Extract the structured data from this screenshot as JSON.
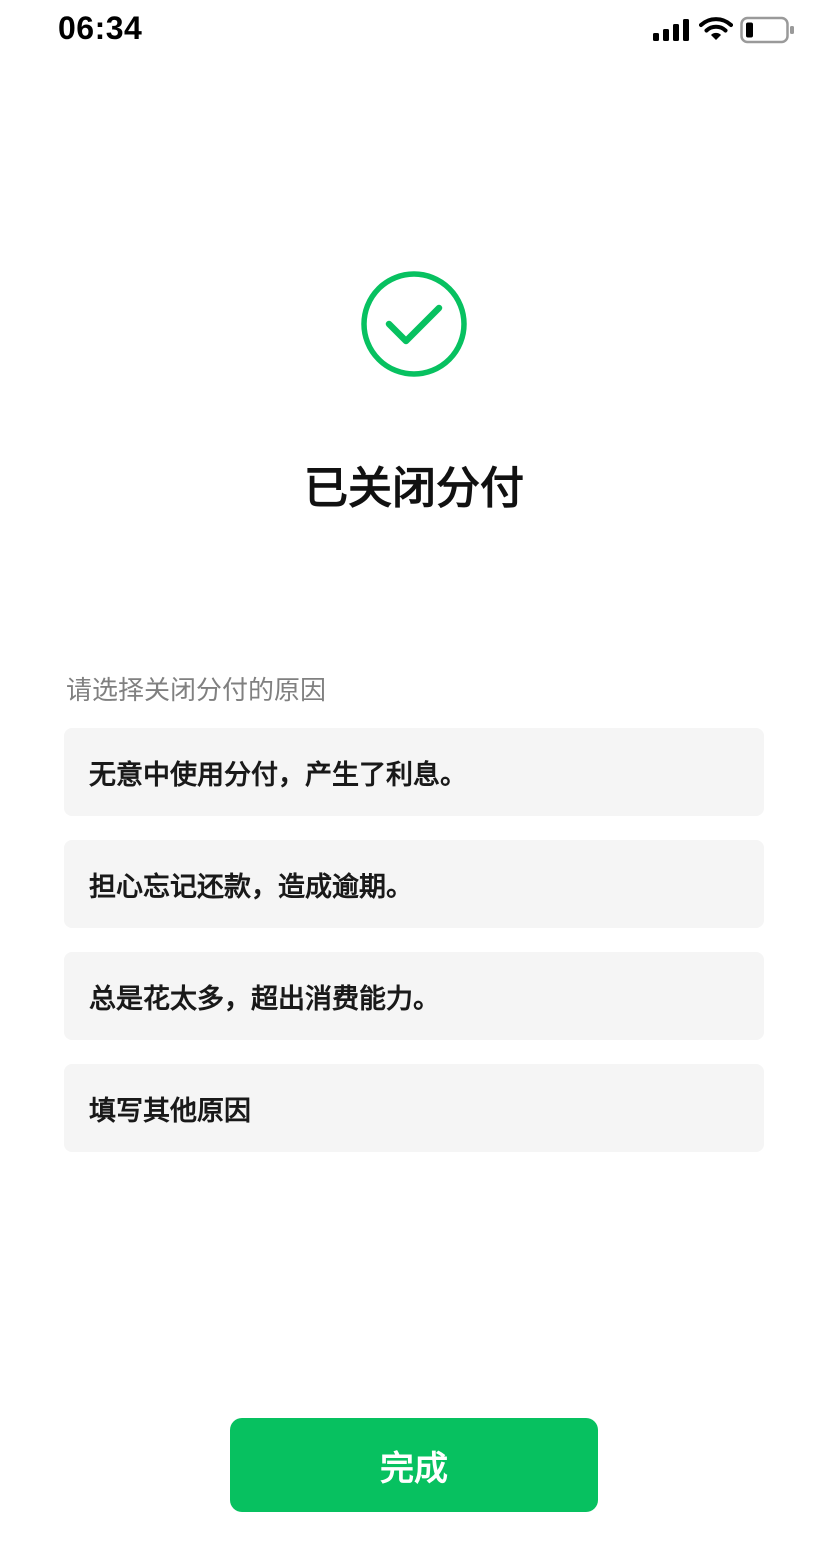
{
  "status_bar": {
    "time": "06:34",
    "icons": [
      "signal-icon",
      "wifi-icon",
      "battery-icon"
    ]
  },
  "success": {
    "icon": "check-circle-icon",
    "color": "#07c160"
  },
  "title": "已关闭分付",
  "prompt": "请选择关闭分付的原因",
  "reasons": [
    {
      "label": "无意中使用分付，产生了利息。"
    },
    {
      "label": "担心忘记还款，造成逾期。"
    },
    {
      "label": "总是花太多，超出消费能力。"
    },
    {
      "label": "填写其他原因"
    }
  ],
  "done_button": {
    "label": "完成",
    "color": "#07c160"
  }
}
